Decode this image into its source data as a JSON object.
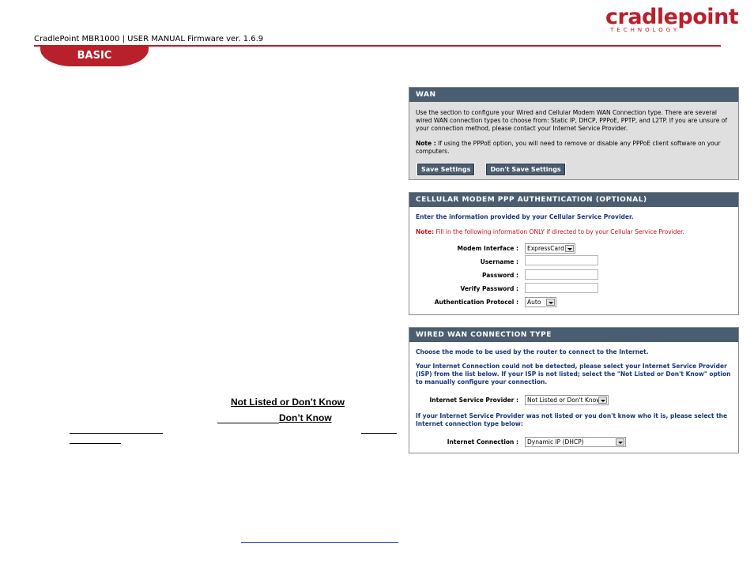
{
  "header": {
    "logo_main": "cradlepoint",
    "logo_sub": "TECHNOLOGY",
    "manual_title": "CradlePoint MBR1000 | USER MANUAL Firmware ver. 1.6.9",
    "section_tab": "BASIC"
  },
  "left_fragments": {
    "not_listed": "Not Listed or Don’t Know",
    "dont_know": "Don’t Know"
  },
  "wan_panel": {
    "title": "WAN",
    "description": "Use the section to configure your Wired and Cellular Modem WAN Connection type. There are several wired WAN connection types to choose from: Static IP, DHCP, PPPoE, PPTP, and L2TP. If you are unsure of your connection method, please contact your Internet Service Provider.",
    "note_label": "Note :",
    "note_text": "If using the PPPoE option, you will need to remove or disable any PPPoE client software on your computers.",
    "save_button": "Save Settings",
    "dont_save_button": "Don't Save Settings"
  },
  "cellular_panel": {
    "title": "CELLULAR MODEM PPP AUTHENTICATION (OPTIONAL)",
    "intro": "Enter the information provided by your Cellular Service Provider.",
    "note_label": "Note:",
    "note_text": "Fill in the following information ONLY if directed to by your Cellular Service Provider.",
    "modem_interface_label": "Modem Interface :",
    "modem_interface_value": "ExpressCard",
    "username_label": "Username :",
    "password_label": "Password :",
    "verify_password_label": "Verify Password :",
    "auth_protocol_label": "Authentication Protocol :",
    "auth_protocol_value": "Auto"
  },
  "wired_panel": {
    "title": "WIRED WAN CONNECTION TYPE",
    "mode_text": "Choose the mode to be used by the router to connect to the Internet.",
    "detect_text": "Your Internet Connection could not be detected, please select your Internet Service Provider (ISP) from the list below. If your ISP is not listed; select the \"Not Listed or Don't Know\" option to manually configure your connection.",
    "isp_label": "Internet Service Provider :",
    "isp_value": "Not Listed or Don't Know",
    "not_listed_text": "If your Internet Service Provider was not listed or you don't know who it is, please select the Internet connection type below:",
    "connection_label": "Internet Connection :",
    "connection_value": "Dynamic IP (DHCP)"
  },
  "colors": {
    "brand_red": "#b8202b",
    "panel_header": "#4b5d70",
    "blue_text": "#16357a",
    "red_text": "#c0141b"
  }
}
